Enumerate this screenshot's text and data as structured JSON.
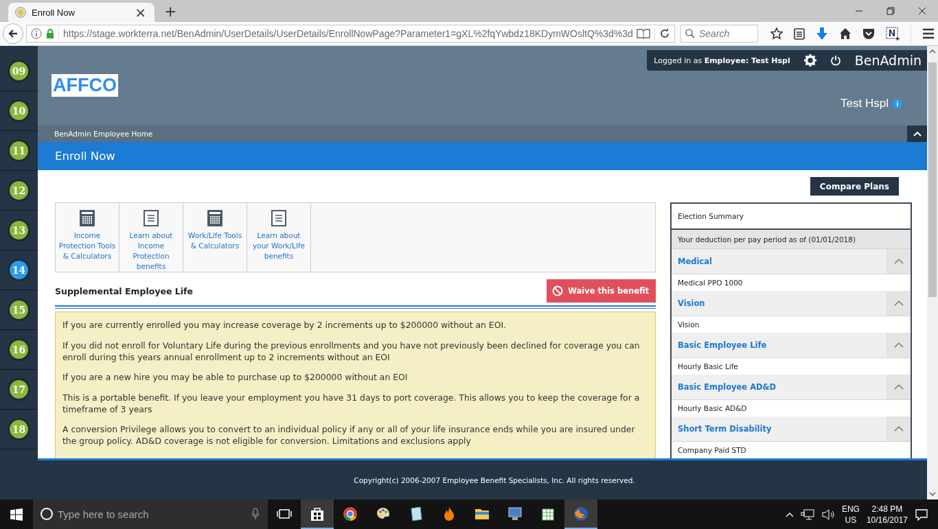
{
  "browser": {
    "tab_title": "Enroll Now",
    "tab_close": "×",
    "new_tab": "+",
    "url": "https://stage.workterra.net/BenAdmin/UserDetails/UserDetails/EnrollNowPage?Parameter1=gXL%2fqYwbdz18KDymWOsltQ%3d%3d",
    "search_placeholder": "Search"
  },
  "sidebar": {
    "steps": [
      {
        "label": "09",
        "selected": false
      },
      {
        "label": "10",
        "selected": false
      },
      {
        "label": "11",
        "selected": false
      },
      {
        "label": "12",
        "selected": false
      },
      {
        "label": "13",
        "selected": false
      },
      {
        "label": "14",
        "selected": true
      },
      {
        "label": "15",
        "selected": false
      },
      {
        "label": "16",
        "selected": false
      },
      {
        "label": "17",
        "selected": false
      },
      {
        "label": "18",
        "selected": false
      }
    ]
  },
  "top_bar": {
    "logged_in": "Logged in as **Employee:  Test Hspl**",
    "app_name": "BenAdmin"
  },
  "header": {
    "logo": "AFFCO",
    "user_name": "Test Hspl"
  },
  "breadcrumb": "BenAdmin Employee Home",
  "page_title": "Enroll Now",
  "compare_button": "Compare Plans",
  "tool_links": [
    {
      "label": "Income Protection Tools & Calculators",
      "kind": "calculator"
    },
    {
      "label": "Learn about Income Protection benefits",
      "kind": "document"
    },
    {
      "label": "Work/Life Tools & Calculators",
      "kind": "calculator"
    },
    {
      "label": "Learn about your Work/Life benefits",
      "kind": "document"
    }
  ],
  "benefit": {
    "title": "Supplemental Employee Life",
    "waive_button": "Waive this benefit",
    "paragraphs": [
      "If you are currently enrolled you may increase coverage by 2 increments up to $200000 without an EOI.",
      "If you did not enroll for Voluntary Life during the previous enrollments and you have not previously been declined for coverage you can enroll during this years annual enrollment up to 2 increments without an EOI",
      "If you are a new hire you may be able to purchase up to $200000 without an EOI",
      "This is a portable benefit. If you leave your employment you have 31 days to port coverage. This allows you to keep the coverage for a timeframe of 3 years",
      "A conversion Privilege allows you to convert to an individual policy if any or all of your life insurance ends while you are insured under the group policy. AD&D coverage is not eligible for conversion. Limitations and exclusions apply"
    ]
  },
  "election_summary": {
    "title": "Election Summary",
    "as_of": "Your deduction per pay period as of (01/01/2018)",
    "sections": [
      {
        "name": "Medical",
        "expanded": true,
        "plans": [
          "Medical PPO 1000"
        ]
      },
      {
        "name": "Vision",
        "expanded": true,
        "plans": [
          "Vision"
        ]
      },
      {
        "name": "Basic Employee Life",
        "expanded": true,
        "plans": [
          "Hourly Basic Life"
        ]
      },
      {
        "name": "Basic Employee AD&D",
        "expanded": true,
        "plans": [
          "Hourly Basic AD&D"
        ]
      },
      {
        "name": "Short Term Disability",
        "expanded": true,
        "plans": [
          "Company Paid STD"
        ]
      }
    ]
  },
  "footer": "Copyright(c) 2006-2007 Employee Benefit Specialists, Inc. All rights reserved.",
  "taskbar": {
    "search_placeholder": "Type here to search",
    "language": "ENG",
    "region": "US",
    "time": "2:48 PM",
    "date": "10/16/2017"
  }
}
